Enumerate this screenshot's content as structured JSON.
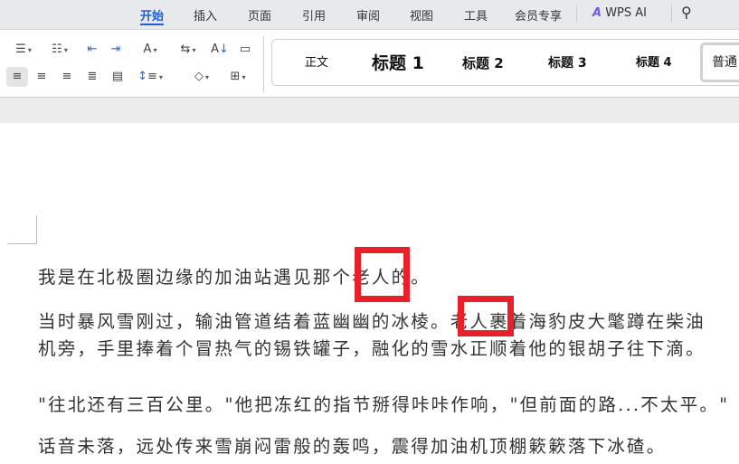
{
  "tabs": [
    {
      "label": "开始",
      "active": true
    },
    {
      "label": "插入"
    },
    {
      "label": "页面"
    },
    {
      "label": "引用"
    },
    {
      "label": "审阅"
    },
    {
      "label": "视图"
    },
    {
      "label": "工具"
    },
    {
      "label": "会员专享"
    }
  ],
  "wps_ai": "WPS AI",
  "icons": [
    "bullet-list",
    "numbered-list",
    "decrease-indent",
    "increase-indent",
    "char-spacing",
    "text-direction",
    "sort",
    "table-border",
    "align-left",
    "align-center",
    "align-right",
    "justify",
    "distributed",
    "line-spacing",
    "shading",
    "borders",
    "search"
  ],
  "styles": {
    "normal": "正文",
    "h1": "标题 1",
    "h2": "标题 2",
    "h3": "标题 3",
    "h4": "标题 4",
    "plain": "普通"
  },
  "document": {
    "lines": [
      "我是在北极圈边缘的加油站遇见那个老人的。",
      "当时暴风雪刚过，输油管道结着蓝幽幽的冰棱。老人裹着海豹皮大氅蹲在柴油",
      "机旁，手里捧着个冒热气的锡铁罐子，融化的雪水正顺着他的银胡子往下滴。",
      "\"往北还有三百公里。\"他把冻红的指节掰得咔咔作响，\"但前面的路...不太平。\"",
      "话音未落，远处传来雪崩闷雷般的轰鸣，震得加油机顶棚簌簌落下冰碴。"
    ]
  },
  "colors": {
    "accent": "#1f5fd6",
    "highlight": "#e8202a"
  }
}
